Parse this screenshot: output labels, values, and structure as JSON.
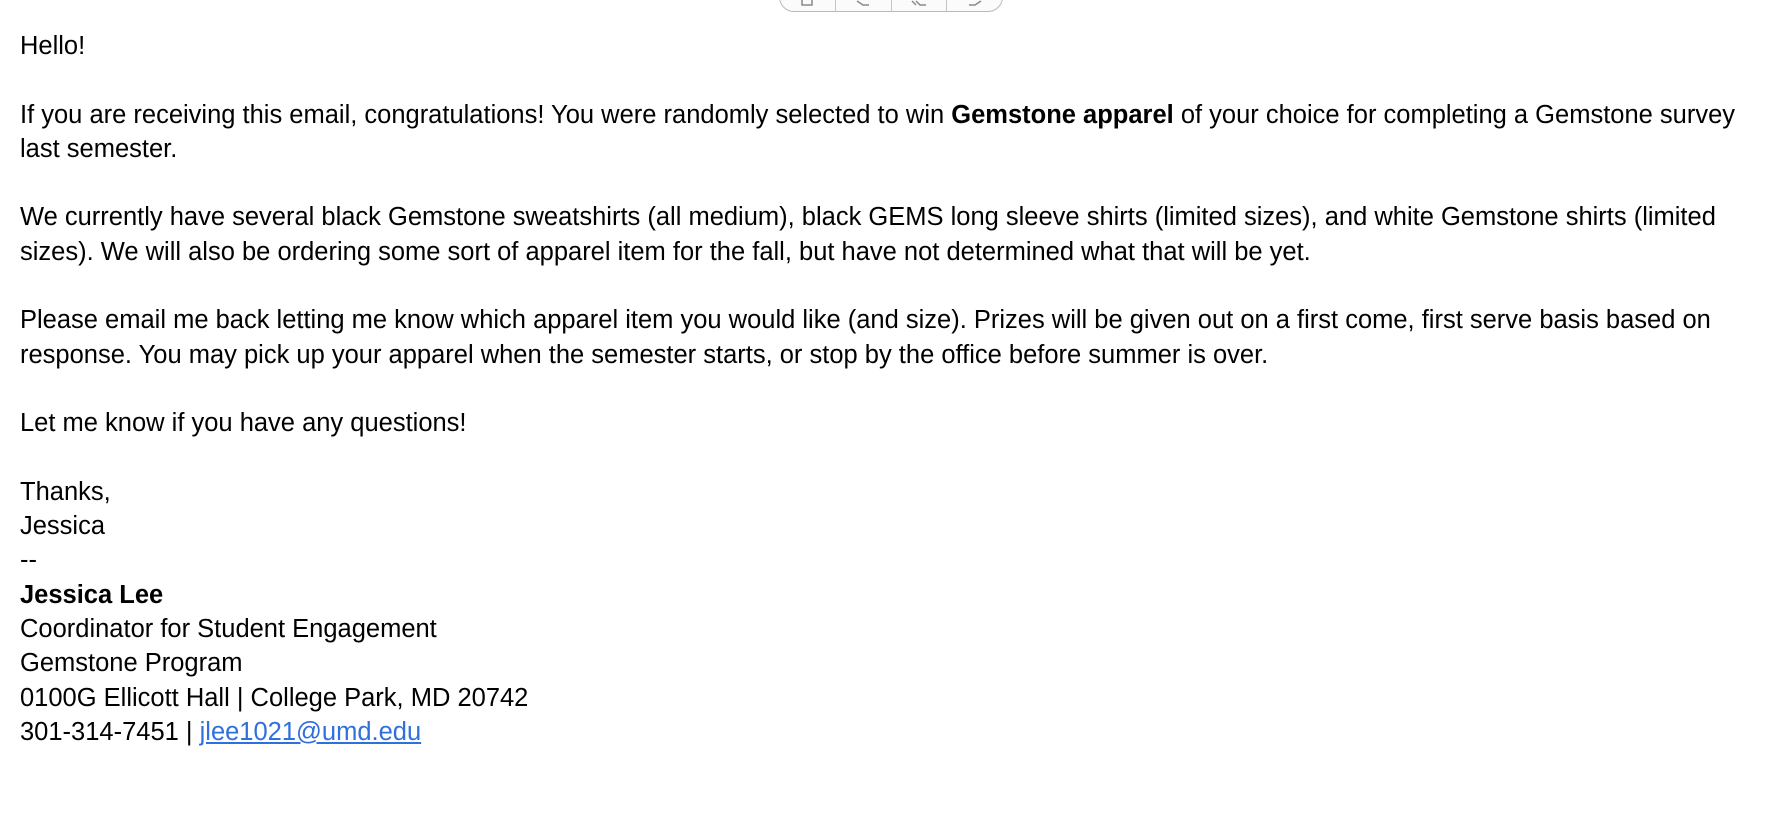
{
  "toolbar": {
    "buttons": [
      {
        "icon": "trash-icon"
      },
      {
        "icon": "reply-icon"
      },
      {
        "icon": "reply-all-icon"
      },
      {
        "icon": "forward-icon"
      }
    ]
  },
  "email": {
    "greeting": "Hello!",
    "para1": {
      "before": "If you are receiving this email, congratulations! You were randomly selected to win ",
      "bold": "Gemstone apparel",
      "after": " of your choice for completing a Gemstone survey last semester."
    },
    "para2": "We currently have several black Gemstone sweatshirts (all medium), black GEMS long sleeve shirts (limited sizes), and white Gemstone shirts (limited sizes). We will also be ordering some sort of apparel item for the fall, but have not determined what that will be yet.",
    "para3": "Please email me back letting me know which apparel item you would like (and size). Prizes will be given out on a first come, first serve basis based on response. You may pick up your apparel when the semester starts, or stop by the office before summer is over.",
    "para4": "Let me know if you have any questions!",
    "closing": "Thanks,",
    "sender_first": "Jessica",
    "sig_separator": "--",
    "signature": {
      "name": "Jessica Lee",
      "title": "Coordinator for Student Engagement",
      "program": "Gemstone Program",
      "address": "0100G Ellicott Hall | College Park, MD 20742",
      "phone_prefix": "301-314-7451 | ",
      "email": "jlee1021@umd.edu"
    }
  },
  "colors": {
    "link": "#2f6fde",
    "text": "#000000",
    "background": "#ffffff"
  }
}
